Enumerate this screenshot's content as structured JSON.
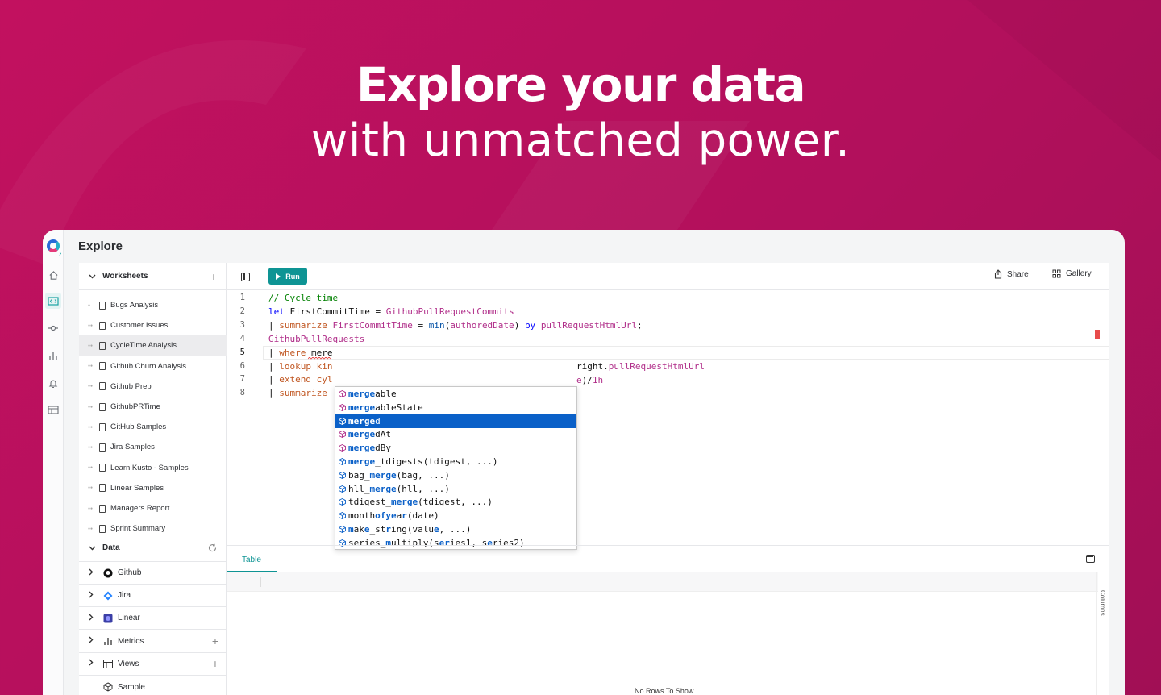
{
  "hero": {
    "title": "Explore your data",
    "subtitle": "with unmatched power."
  },
  "app": {
    "page_title": "Explore",
    "rail": [
      "home-icon",
      "explore-icon",
      "insights-icon",
      "metrics-icon",
      "bell-icon",
      "table-icon"
    ],
    "worksheets": {
      "header": "Worksheets",
      "items": [
        "Bugs Analysis",
        "Customer Issues",
        "CycleTime Analysis",
        "Github Churn Analysis",
        "Github Prep",
        "GithubPRTime",
        "GitHub Samples",
        "Jira Samples",
        "Learn Kusto - Samples",
        "Linear Samples",
        "Managers Report",
        "Sprint Summary"
      ],
      "selected_index": 2
    },
    "data": {
      "header": "Data",
      "items": [
        "Github",
        "Jira",
        "Linear",
        "Metrics",
        "Views",
        "Sample"
      ]
    },
    "toolbar": {
      "run_label": "Run",
      "share_label": "Share",
      "gallery_label": "Gallery"
    },
    "editor": {
      "line_numbers": [
        "1",
        "2",
        "3",
        "4",
        "5",
        "6",
        "7",
        "8"
      ],
      "current_line": 5,
      "lines": [
        [
          [
            "cm",
            "// Cycle time"
          ]
        ],
        [
          [
            "kw",
            "let "
          ],
          [
            "tx",
            "FirstCommitTime = "
          ],
          [
            "tb",
            "GithubPullRequestCommits"
          ]
        ],
        [
          [
            "tx",
            "| "
          ],
          [
            "op",
            "summarize "
          ],
          [
            "tb",
            "FirstCommitTime"
          ],
          [
            "tx",
            " = "
          ],
          [
            "fn",
            "min"
          ],
          [
            "tx",
            "("
          ],
          [
            "tb",
            "authoredDate"
          ],
          [
            "tx",
            ") "
          ],
          [
            "kw",
            "by "
          ],
          [
            "tb",
            "pullRequestHtmlUrl"
          ],
          [
            "tx",
            ";"
          ]
        ],
        [
          [
            "tb",
            "GithubPullRequests"
          ]
        ],
        [
          [
            "tx",
            "| "
          ],
          [
            "op",
            "where "
          ],
          [
            "tx",
            "mere"
          ]
        ],
        [
          [
            "tx",
            "| "
          ],
          [
            "op",
            "lookup kin"
          ]
        ],
        [
          [
            "tx",
            "| "
          ],
          [
            "op",
            "extend cyl"
          ]
        ],
        [
          [
            "tx",
            "| "
          ],
          [
            "op",
            "summarize "
          ]
        ]
      ],
      "line6_tail": [
        [
          "tx",
          "right."
        ],
        [
          "tb",
          "pullRequestHtmlUrl"
        ]
      ],
      "line7_tail": [
        [
          "tb",
          "e"
        ],
        [
          "tx",
          ")/"
        ],
        [
          "tb",
          "1h"
        ]
      ]
    },
    "autocomplete": {
      "selected_index": 2,
      "items": [
        {
          "kind": "column",
          "parts": [
            [
              "b",
              "merge"
            ],
            [
              "",
              "able"
            ]
          ]
        },
        {
          "kind": "column",
          "parts": [
            [
              "b",
              "merge"
            ],
            [
              "",
              "ableState"
            ]
          ]
        },
        {
          "kind": "column",
          "parts": [
            [
              "b",
              "merge"
            ],
            [
              "",
              "d"
            ]
          ]
        },
        {
          "kind": "column",
          "parts": [
            [
              "b",
              "merge"
            ],
            [
              "",
              "dAt"
            ]
          ]
        },
        {
          "kind": "column",
          "parts": [
            [
              "b",
              "merge"
            ],
            [
              "",
              "dBy"
            ]
          ]
        },
        {
          "kind": "function",
          "parts": [
            [
              "b",
              "merge"
            ],
            [
              "",
              "_tdigests(tdigest, ...)"
            ]
          ]
        },
        {
          "kind": "function",
          "parts": [
            [
              "",
              "bag_"
            ],
            [
              "b",
              "merge"
            ],
            [
              "",
              "(bag, ...)"
            ]
          ]
        },
        {
          "kind": "function",
          "parts": [
            [
              "",
              "hll_"
            ],
            [
              "b",
              "merge"
            ],
            [
              "",
              "(hll, ...)"
            ]
          ]
        },
        {
          "kind": "function",
          "parts": [
            [
              "",
              "tdigest_"
            ],
            [
              "b",
              "merge"
            ],
            [
              "",
              "(tdigest, ...)"
            ]
          ]
        },
        {
          "kind": "function",
          "parts": [
            [
              "",
              "month"
            ],
            [
              "b",
              "ofye"
            ],
            [
              "",
              "a"
            ],
            [
              "b",
              "r"
            ],
            [
              "",
              "(date)"
            ]
          ]
        },
        {
          "kind": "function",
          "parts": [
            [
              "b",
              "m"
            ],
            [
              "",
              "ak"
            ],
            [
              "b",
              "e"
            ],
            [
              "",
              "_st"
            ],
            [
              "b",
              "r"
            ],
            [
              "",
              "ing(valu"
            ],
            [
              "b",
              "e"
            ],
            [
              "",
              ", ...)"
            ]
          ]
        },
        {
          "kind": "function",
          "parts": [
            [
              "",
              "series_"
            ],
            [
              "b",
              "m"
            ],
            [
              "",
              "ultiply(s"
            ],
            [
              "b",
              "er"
            ],
            [
              "",
              "ies1, s"
            ],
            [
              "b",
              "e"
            ],
            [
              "",
              "ries2)"
            ]
          ]
        }
      ]
    },
    "results": {
      "tab_label": "Table",
      "columns_label": "Columns",
      "empty_label": "No Rows To Show"
    },
    "colors": {
      "accent": "#0e9494",
      "brand_bg": "#c2115f",
      "selection": "#0a60c8"
    }
  }
}
